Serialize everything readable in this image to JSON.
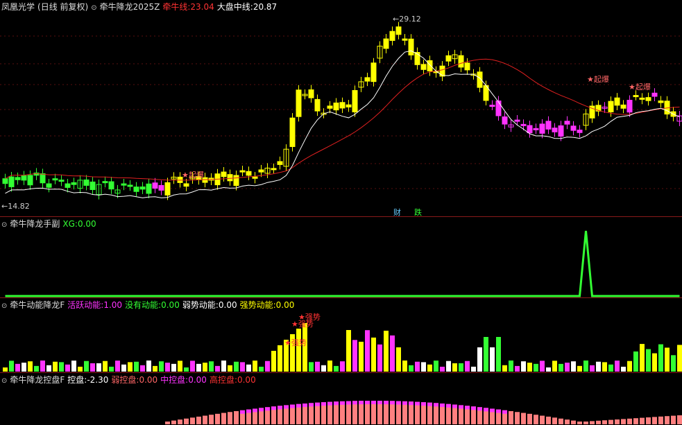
{
  "main": {
    "stock_name": "凤凰光学",
    "period": "(日线 前复权)",
    "indicator": "牵牛降龙2025Z",
    "line1_label": "牵牛线:",
    "line1_value": "23.04",
    "line2_label": "大盘中线:",
    "line2_value": "20.87",
    "high_label": "29.12",
    "low_label": "14.82",
    "signals": [
      "起爆",
      "起爆",
      "起爆"
    ],
    "event_labels": [
      "财",
      "跌"
    ],
    "colors": {
      "up": "#ffff00",
      "down": "#33ff33",
      "magenta": "#ff33ff",
      "ma_red": "#e02020",
      "ma_white": "#ffffff"
    }
  },
  "panel2": {
    "name": "牵牛降龙手副",
    "xg_label": "XG:",
    "xg_value": "0.00"
  },
  "panel3": {
    "name": "牵牛动能降龙F",
    "items": [
      {
        "label": "活跃动能:",
        "value": "1.00",
        "color": "#ff33ff"
      },
      {
        "label": "没有动能:",
        "value": "0.00",
        "color": "#33ff33"
      },
      {
        "label": "弱势动能:",
        "value": "0.00",
        "color": "#ffffff"
      },
      {
        "label": "强势动能:",
        "value": "0.00",
        "color": "#ffff00"
      }
    ],
    "signals": [
      "强势",
      "强势",
      "强势"
    ]
  },
  "panel4": {
    "name": "牵牛降龙控盘F",
    "items": [
      {
        "label": "控盘:",
        "value": "-2.30",
        "color": "#ffffff"
      },
      {
        "label": "弱控盘:",
        "value": "0.00",
        "color": "#ff6666"
      },
      {
        "label": "中控盘:",
        "value": "0.00",
        "color": "#ff33ff"
      },
      {
        "label": "高控盘:",
        "value": "0.00",
        "color": "#ff3333"
      }
    ]
  }
}
